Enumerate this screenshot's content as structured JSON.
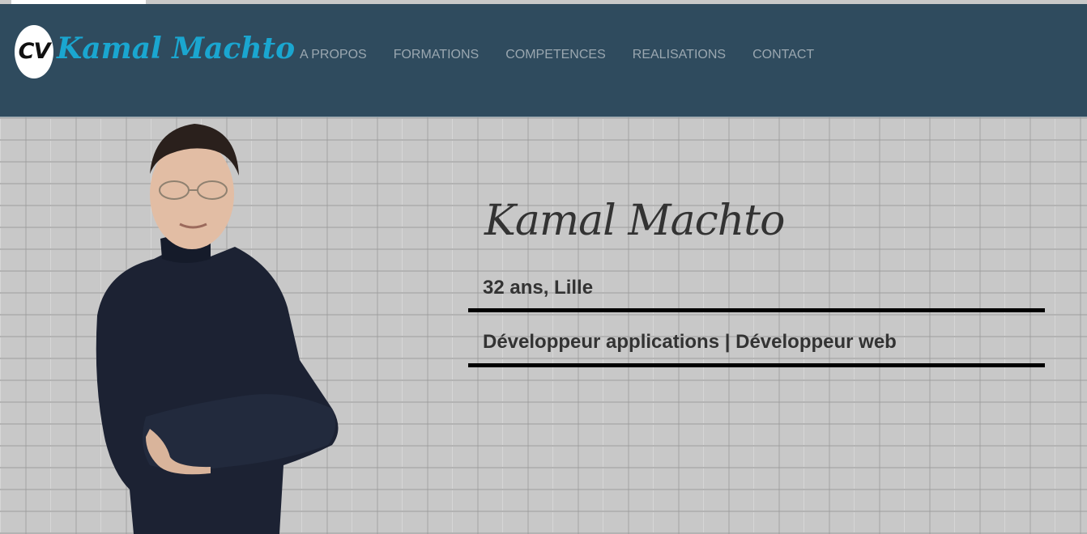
{
  "logo": {
    "badge": "CV",
    "name": "Kamal Machto"
  },
  "nav": {
    "items": [
      {
        "label": "A PROPOS"
      },
      {
        "label": "FORMATIONS"
      },
      {
        "label": "COMPETENCES"
      },
      {
        "label": "REALISATIONS"
      },
      {
        "label": "CONTACT"
      }
    ]
  },
  "hero": {
    "name": "Kamal Machto",
    "age_city": "32 ans, Lille",
    "job_title": "Développeur applications | Développeur web"
  },
  "colors": {
    "navbar_bg": "#2f4b5e",
    "logo_accent": "#1aa6d0",
    "nav_text": "#9aa7b0",
    "hero_bg": "#c8c8c8",
    "hero_text": "#333333"
  }
}
